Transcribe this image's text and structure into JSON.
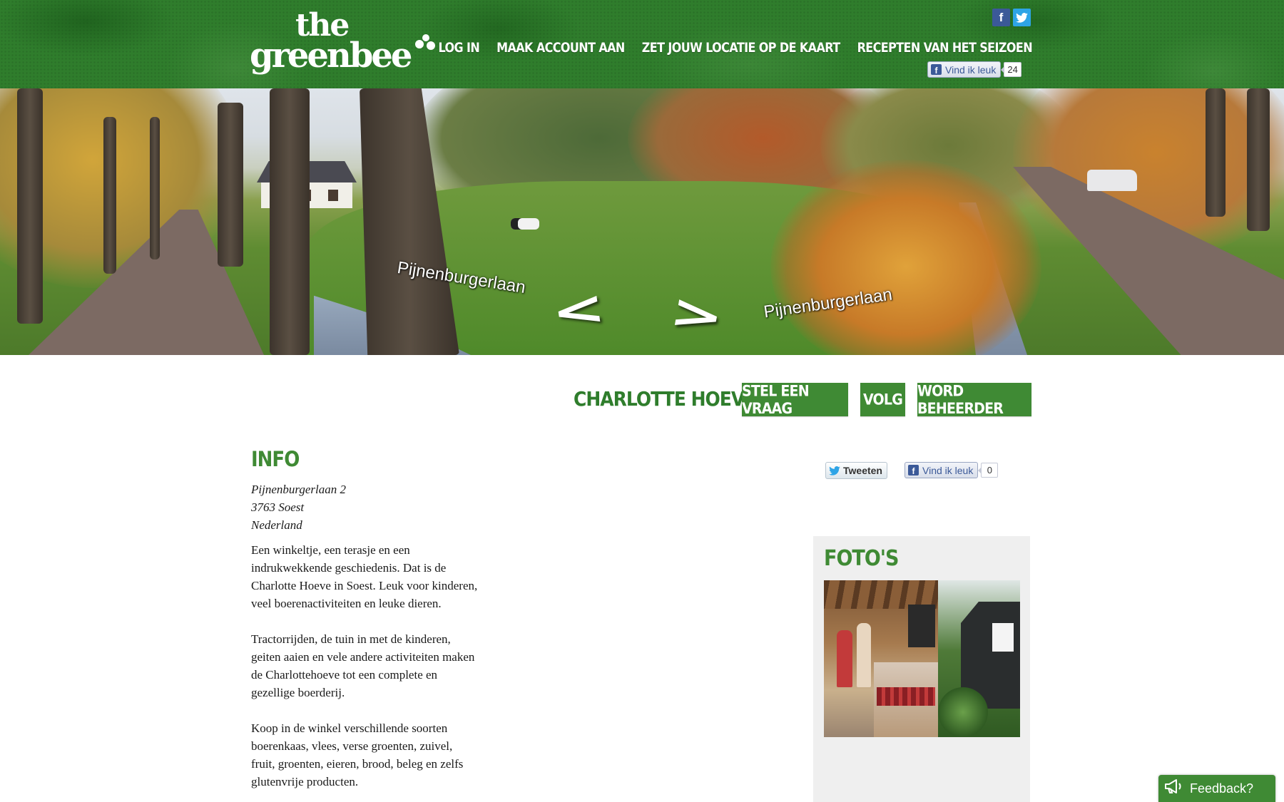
{
  "header": {
    "logo_top": "the",
    "logo_bottom": "greenbee",
    "social": [
      {
        "icon": "facebook-icon",
        "glyph": "f"
      },
      {
        "icon": "twitter-icon",
        "glyph": "t"
      }
    ],
    "nav": [
      "LOG IN",
      "MAAK ACCOUNT AAN",
      "ZET JOUW LOCATIE OP DE KAART",
      "RECEPTEN VAN HET SEIZOEN"
    ],
    "like": {
      "label": "Vind ik leuk",
      "count": "24"
    }
  },
  "streetview": {
    "label_left": "Pijnenburgerlaan",
    "label_right": "Pijnenburgerlaan",
    "arrow_left": "<",
    "arrow_right": ">"
  },
  "farm": {
    "title": "CHARLOTTE HOEVE",
    "buttons": [
      "STEL EEN VRAAG",
      "VOLG",
      "WORD BEHEERDER"
    ]
  },
  "info": {
    "heading": "INFO",
    "address": [
      "Pijnenburgerlaan 2",
      "3763 Soest",
      "Nederland"
    ],
    "paragraphs": [
      "Een winkeltje, een terasje en een indrukwekkende geschiedenis. Dat is de Charlotte Hoeve in Soest. Leuk voor kinderen, veel boerenactiviteiten en leuke dieren.",
      "Tractorrijden, de tuin in met de kinderen, geiten aaien en vele andere activiteiten maken de Charlottehoeve tot een complete en gezellige boerderij.",
      "Koop in de winkel verschillende soorten boerenkaas, vlees, verse groenten, zuivel, fruit, groenten, eieren, brood, beleg en zelfs glutenvrije producten."
    ]
  },
  "share": {
    "tweet_label": "Tweeten",
    "like_label": "Vind ik leuk",
    "like_count": "0"
  },
  "photos": {
    "heading": "FOTO'S"
  },
  "feedback": {
    "label": "Feedback?"
  },
  "colors": {
    "brand_green": "#3f8a34",
    "header_green": "#2f7d2c",
    "facebook_blue": "#3b5998",
    "twitter_blue": "#2ea4e6"
  }
}
